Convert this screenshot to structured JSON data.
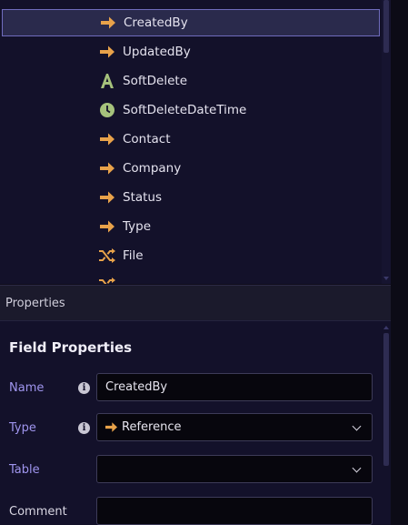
{
  "tree": {
    "items": [
      {
        "label": "CreatedBy",
        "icon": "arrow-right-icon",
        "selected": true
      },
      {
        "label": "UpdatedBy",
        "icon": "arrow-right-icon"
      },
      {
        "label": "SoftDelete",
        "icon": "text-a-icon"
      },
      {
        "label": "SoftDeleteDateTime",
        "icon": "clock-icon"
      },
      {
        "label": "Contact",
        "icon": "arrow-right-icon"
      },
      {
        "label": "Company",
        "icon": "arrow-right-icon"
      },
      {
        "label": "Status",
        "icon": "arrow-right-icon"
      },
      {
        "label": "Type",
        "icon": "arrow-right-icon"
      },
      {
        "label": "File",
        "icon": "shuffle-icon"
      }
    ]
  },
  "properties": {
    "header": "Properties",
    "section_title": "Field Properties",
    "fields": {
      "name": {
        "label": "Name",
        "value": "CreatedBy"
      },
      "type": {
        "label": "Type",
        "value": "Reference",
        "icon": "arrow-right-icon"
      },
      "table": {
        "label": "Table",
        "value": ""
      },
      "comment": {
        "label": "Comment",
        "value": ""
      }
    }
  },
  "colors": {
    "accent_label": "#9f95ee",
    "icon_orange": "#e8a24a",
    "icon_green": "#a6c27c",
    "selection_border": "#6f6cbd"
  }
}
